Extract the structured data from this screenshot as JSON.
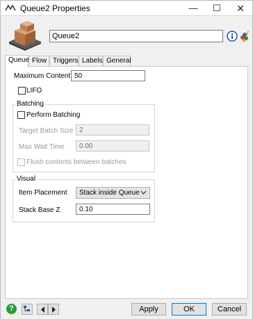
{
  "window": {
    "title": "Queue2  Properties",
    "controls": {
      "minimize": "—",
      "maximize": "☐",
      "close": "✕"
    }
  },
  "header": {
    "object_name": "Queue2",
    "icons": [
      "queue-object-icon",
      "info-icon",
      "color-palette-icon"
    ]
  },
  "tabs": [
    {
      "label": "Queue",
      "active": true
    },
    {
      "label": "Flow",
      "active": false
    },
    {
      "label": "Triggers",
      "active": false
    },
    {
      "label": "Labels",
      "active": false
    },
    {
      "label": "General",
      "active": false
    }
  ],
  "queue_tab": {
    "maximum_content": {
      "label": "Maximum Content",
      "value": "50"
    },
    "lifo": {
      "label": "LIFO",
      "checked": false
    },
    "batching": {
      "title": "Batching",
      "perform_batching": {
        "label": "Perform Batching",
        "checked": false
      },
      "target_batch_size": {
        "label": "Target Batch Size",
        "value": "2",
        "enabled": false
      },
      "max_wait_time": {
        "label": "Max Wait Time",
        "value": "0.00",
        "enabled": false
      },
      "flush_contents": {
        "label": "Flush contents between batches",
        "checked": false,
        "enabled": false
      }
    },
    "visual": {
      "title": "Visual",
      "item_placement": {
        "label": "Item Placement",
        "selected": "Stack inside Queue"
      },
      "stack_base_z": {
        "label": "Stack Base Z",
        "value": "0.10"
      }
    }
  },
  "footer": {
    "help_label": "?",
    "apply_label": "Apply",
    "ok_label": "OK",
    "cancel_label": "Cancel"
  },
  "colors": {
    "help_green": "#2e9b3c",
    "ok_border": "#0078d7",
    "disabled_text": "#9a9a9a"
  }
}
